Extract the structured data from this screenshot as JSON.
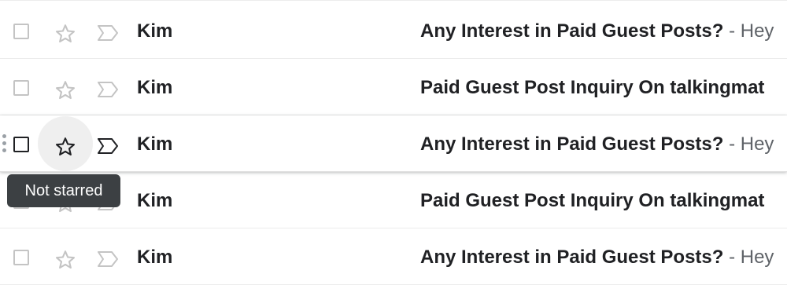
{
  "emails": [
    {
      "sender": "Kim",
      "subject": "Any Interest in Paid Guest Posts?",
      "snippet": "- Hey",
      "starred": false,
      "hovered": false
    },
    {
      "sender": "Kim",
      "subject": "Paid Guest Post Inquiry On talkingmat",
      "snippet": "",
      "starred": false,
      "hovered": false
    },
    {
      "sender": "Kim",
      "subject": "Any Interest in Paid Guest Posts?",
      "snippet": "- Hey",
      "starred": false,
      "hovered": true
    },
    {
      "sender": "Kim",
      "subject": "Paid Guest Post Inquiry On talkingmat",
      "snippet": "",
      "starred": false,
      "hovered": false
    },
    {
      "sender": "Kim",
      "subject": "Any Interest in Paid Guest Posts?",
      "snippet": "- Hey",
      "starred": false,
      "hovered": false
    }
  ],
  "tooltip": {
    "text": "Not starred"
  },
  "icons": {
    "checkbox": "checkbox-icon",
    "star": "star-outline-icon",
    "important": "important-marker-icon",
    "drag": "drag-handle-icon"
  },
  "colors": {
    "text_primary": "#202124",
    "text_secondary": "#5f6368",
    "icon_idle": "#c4c4c4",
    "icon_active": "#202124",
    "tooltip_bg": "#3c4043",
    "divider": "#ececec"
  }
}
